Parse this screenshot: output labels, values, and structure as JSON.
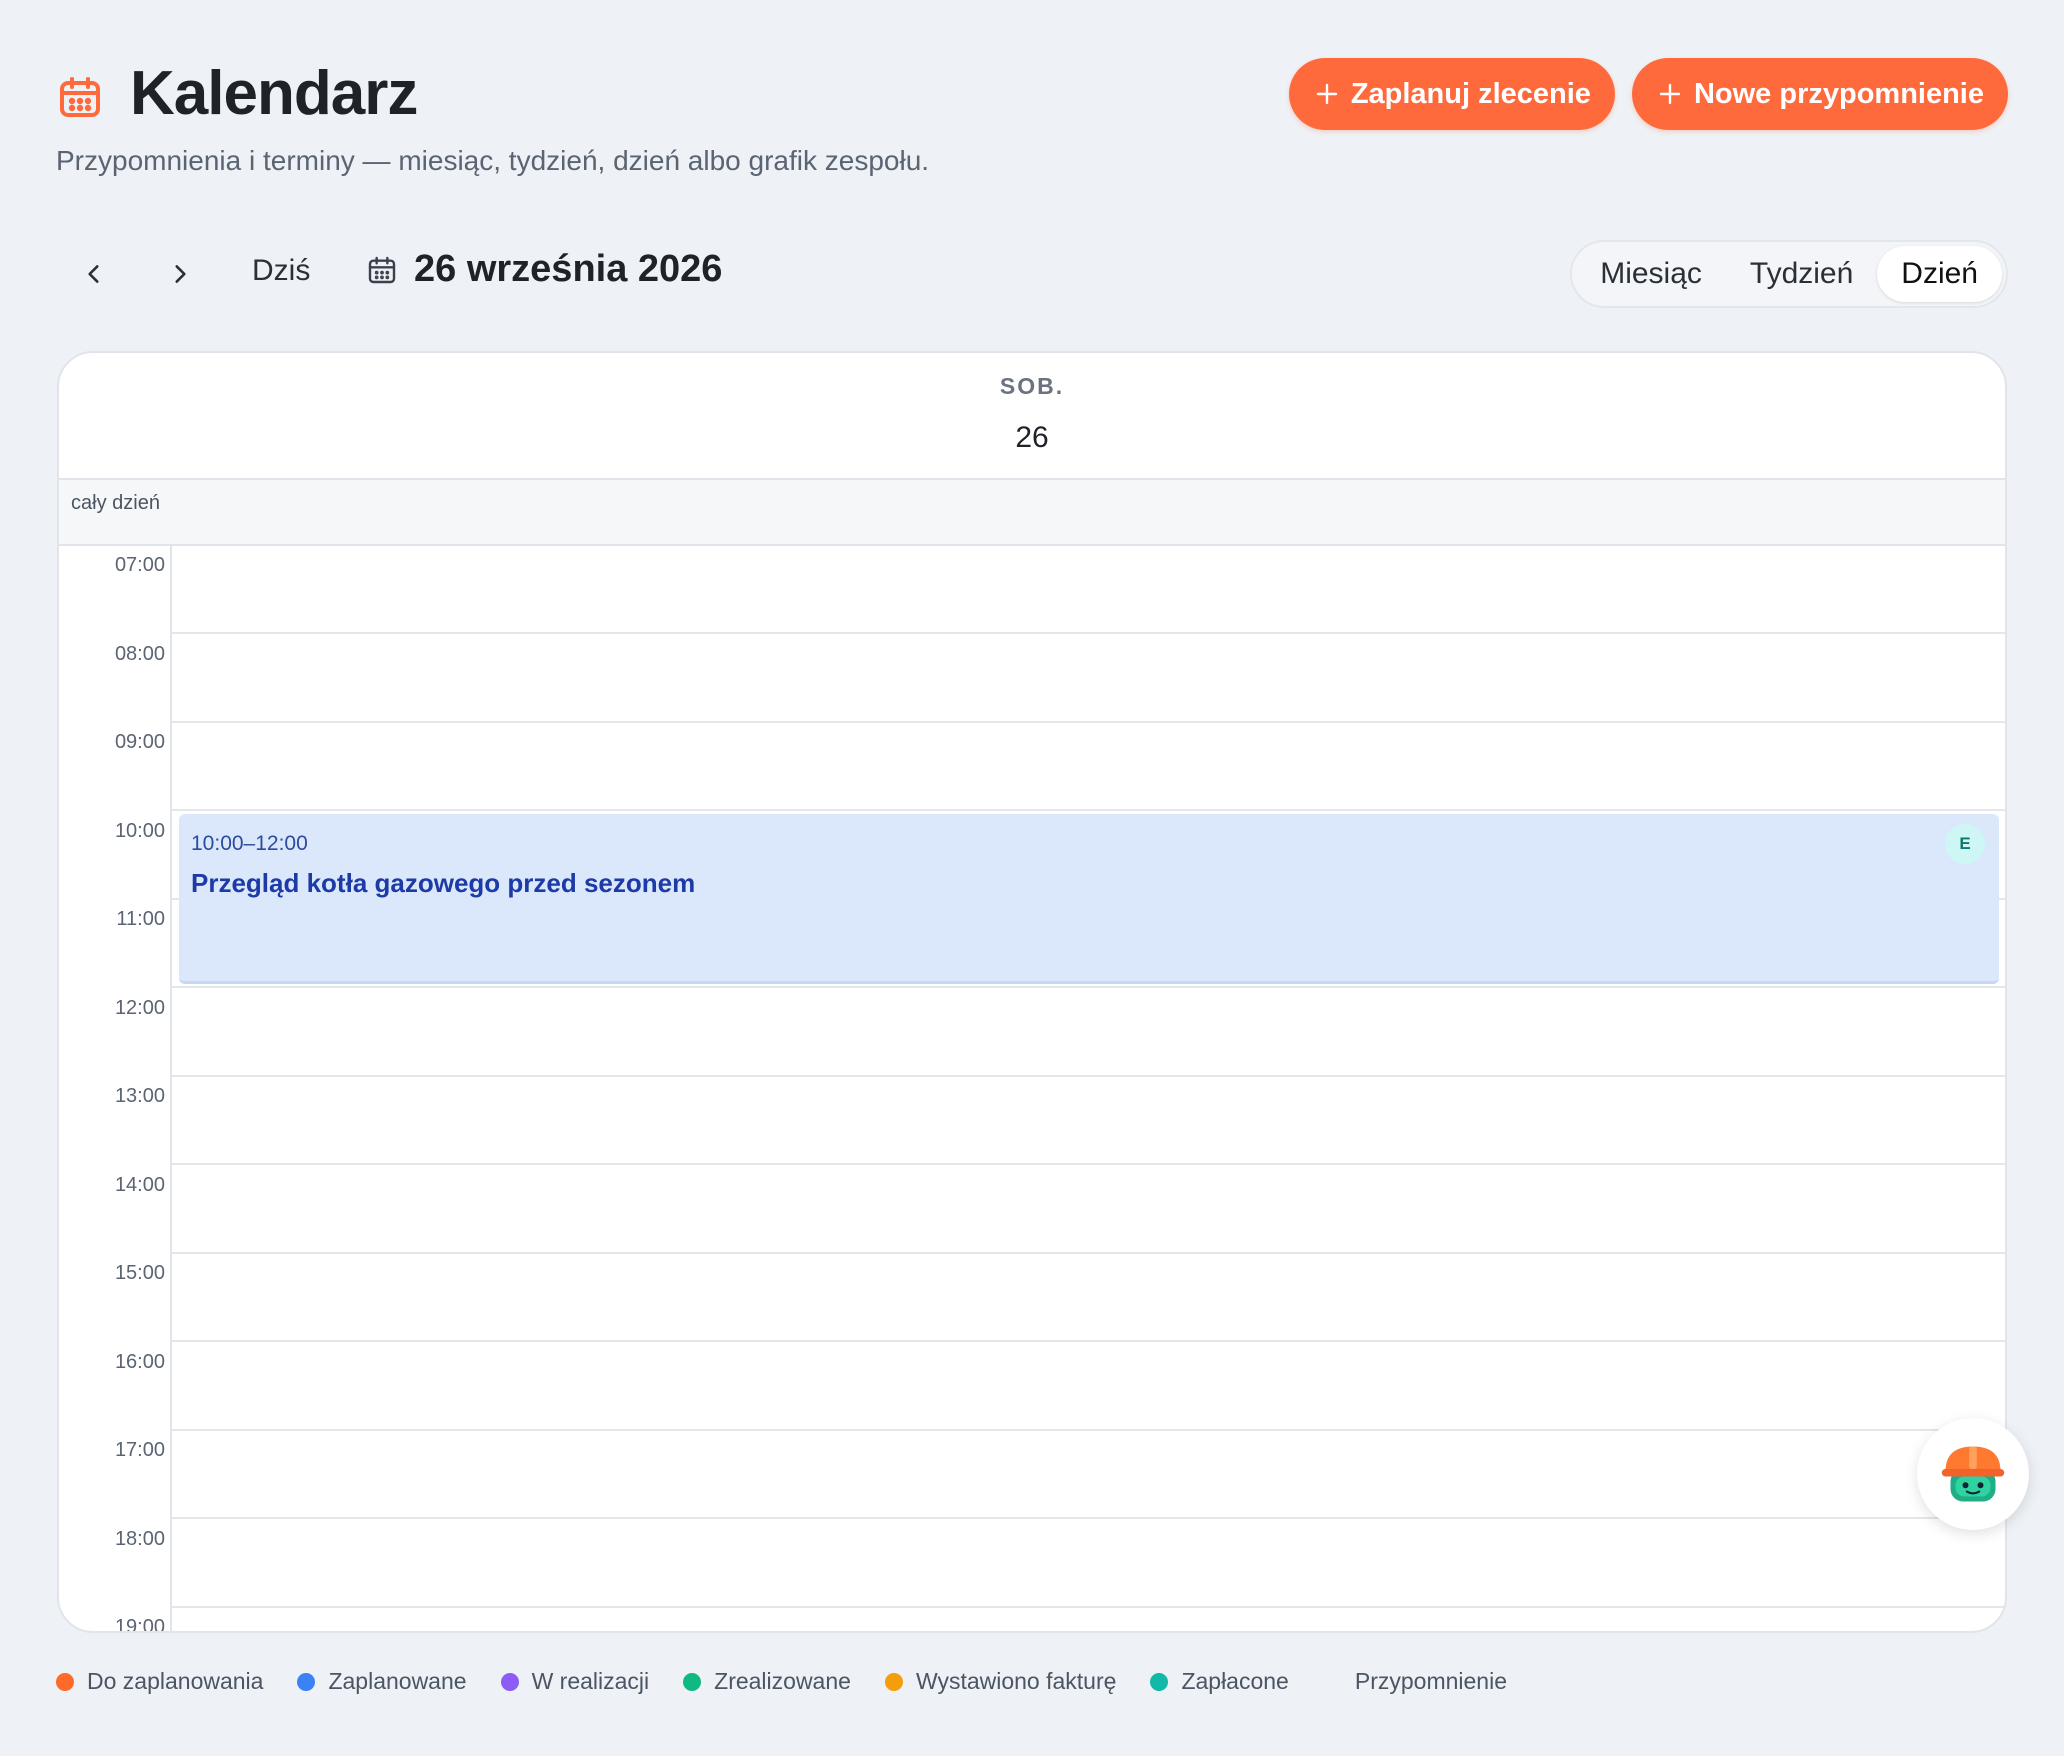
{
  "header": {
    "title": "Kalendarz",
    "subtitle": "Przypomnienia i terminy — miesiąc, tydzień, dzień albo grafik zespołu.",
    "icon": "calendar-icon",
    "actions": [
      {
        "label": "Zaplanuj zlecenie",
        "icon": "plus-icon"
      },
      {
        "label": "Nowe przypomnienie",
        "icon": "plus-icon"
      }
    ]
  },
  "toolbar": {
    "prev_icon": "chevron-left-icon",
    "next_icon": "chevron-right-icon",
    "today_label": "Dziś",
    "current_date": "26 września 2026",
    "views": [
      {
        "label": "Miesiąc",
        "active": false
      },
      {
        "label": "Tydzień",
        "active": false
      },
      {
        "label": "Dzień",
        "active": true
      }
    ]
  },
  "calendar": {
    "day_name": "SOB.",
    "day_number": "26",
    "allday_label": "cały dzień",
    "hours": [
      "07:00",
      "08:00",
      "09:00",
      "10:00",
      "11:00",
      "12:00",
      "13:00",
      "14:00",
      "15:00",
      "16:00",
      "17:00",
      "18:00",
      "19:00"
    ],
    "event": {
      "time": "10:00–12:00",
      "title": "Przegląd kotła gazowego przed sezonem",
      "badge": "E"
    }
  },
  "legend": [
    {
      "label": "Do zaplanowania",
      "color": "#ff6a2b"
    },
    {
      "label": "Zaplanowane",
      "color": "#3b82f6"
    },
    {
      "label": "W realizacji",
      "color": "#8b5cf6"
    },
    {
      "label": "Zrealizowane",
      "color": "#10b981"
    },
    {
      "label": "Wystawiono fakturę",
      "color": "#f59e0b"
    },
    {
      "label": "Zapłacone",
      "color": "#14b8a6"
    }
  ],
  "legend_extra": "Przypomnienie",
  "assistant": {
    "icon": "assistant-helmet-icon"
  },
  "colors": {
    "accent": "#ff6a3d",
    "event_bg": "#dbe8fc",
    "event_text": "#1d3aa7"
  }
}
